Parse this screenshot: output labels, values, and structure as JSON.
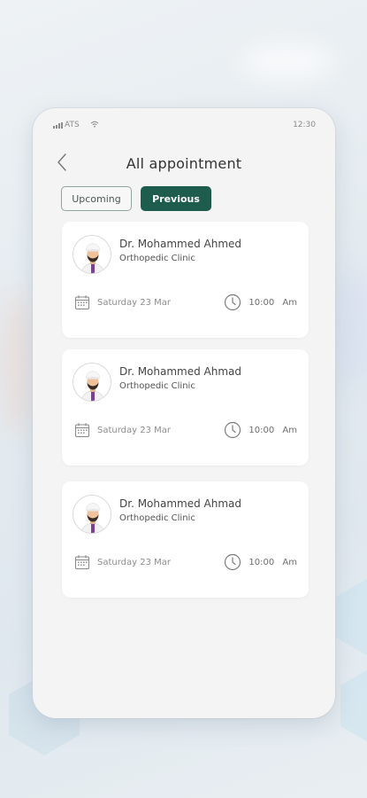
{
  "status_bar": {
    "carrier": "ATS",
    "time": "12:30"
  },
  "header": {
    "title": "All appointment"
  },
  "tabs": [
    {
      "label": "Upcoming",
      "active": false
    },
    {
      "label": "Previous",
      "active": true
    }
  ],
  "appointments": [
    {
      "doctor": "Dr. Mohammed Ahmed",
      "clinic": "Orthopedic Clinic",
      "date": "Saturday 23 Mar",
      "time": "10:00  Am"
    },
    {
      "doctor": "Dr. Mohammed Ahmad",
      "clinic": "Orthopedic Clinic",
      "date": "Saturday 23 Mar",
      "time": "10:00  Am"
    },
    {
      "doctor": "Dr. Mohammed Ahmad",
      "clinic": "Orthopedic Clinic",
      "date": "Saturday 23 Mar",
      "time": "10:00  Am"
    }
  ],
  "colors": {
    "accent": "#1e5c4e",
    "background": "#f4f4f4",
    "card": "#ffffff"
  },
  "icons": {
    "back": "chevron-left-icon",
    "date": "calendar-icon",
    "time": "clock-icon"
  }
}
